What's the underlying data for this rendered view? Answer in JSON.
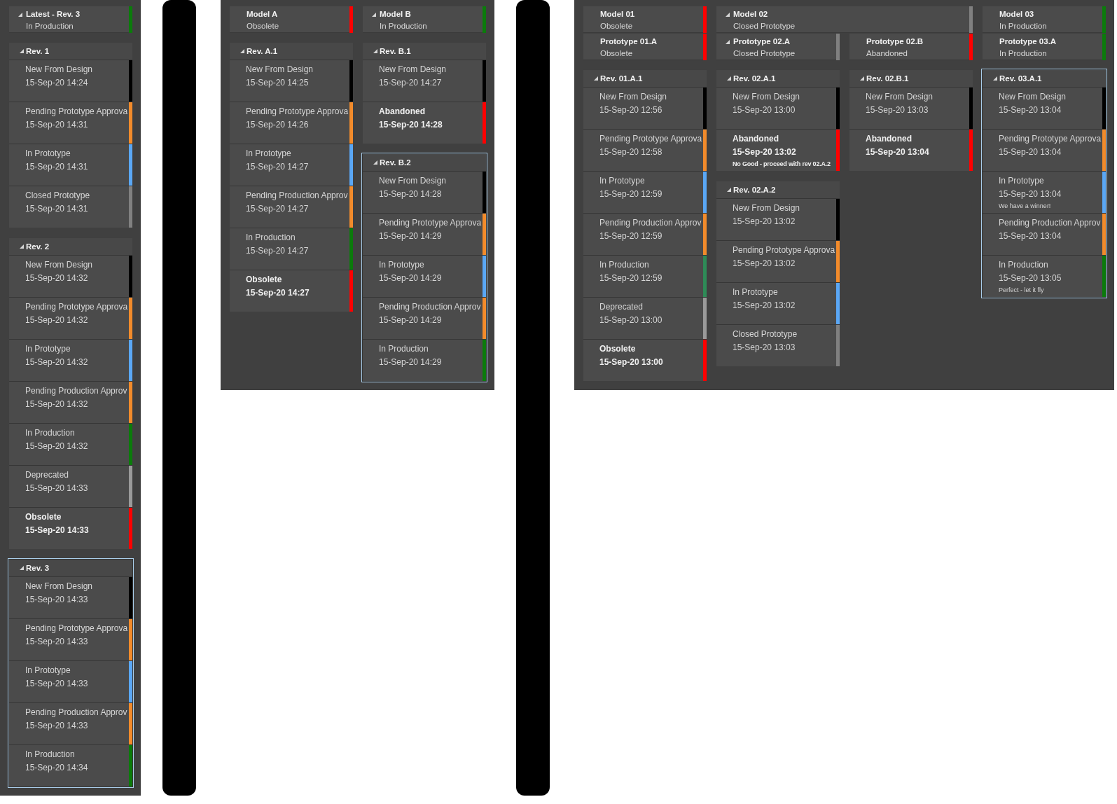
{
  "panels": [
    {
      "nodes": [
        {
          "title": "Latest - Rev. 3",
          "status": "In Production",
          "color": "#0b7b0b",
          "expand_arrow": true,
          "revisions": [
            {
              "title": "Rev. 1",
              "selected": false,
              "states": [
                {
                  "label": "New From Design",
                  "time": "15-Sep-20 14:24",
                  "color": "#000000",
                  "emphasized": false
                },
                {
                  "label": "Pending Prototype Approva",
                  "time": "15-Sep-20 14:31",
                  "color": "#f28b2b",
                  "emphasized": false
                },
                {
                  "label": "In Prototype",
                  "time": "15-Sep-20 14:31",
                  "color": "#5aa7f5",
                  "emphasized": false
                },
                {
                  "label": "Closed Prototype",
                  "time": "15-Sep-20 14:31",
                  "color": "#808080",
                  "emphasized": false
                }
              ]
            },
            {
              "title": "Rev. 2",
              "selected": false,
              "states": [
                {
                  "label": "New From Design",
                  "time": "15-Sep-20 14:32",
                  "color": "#000000",
                  "emphasized": false
                },
                {
                  "label": "Pending Prototype Approva",
                  "time": "15-Sep-20 14:32",
                  "color": "#f28b2b",
                  "emphasized": false
                },
                {
                  "label": "In Prototype",
                  "time": "15-Sep-20 14:32",
                  "color": "#5aa7f5",
                  "emphasized": false
                },
                {
                  "label": "Pending Production Approv",
                  "time": "15-Sep-20 14:32",
                  "color": "#f28b2b",
                  "emphasized": false
                },
                {
                  "label": "In Production",
                  "time": "15-Sep-20 14:32",
                  "color": "#0b7b0b",
                  "emphasized": false
                },
                {
                  "label": "Deprecated",
                  "time": "15-Sep-20 14:33",
                  "color": "#9a9a9a",
                  "emphasized": false
                },
                {
                  "label": "Obsolete",
                  "time": "15-Sep-20 14:33",
                  "color": "#ff0000",
                  "emphasized": true
                }
              ]
            },
            {
              "title": "Rev. 3",
              "selected": true,
              "states": [
                {
                  "label": "New From Design",
                  "time": "15-Sep-20 14:33",
                  "color": "#000000",
                  "emphasized": false
                },
                {
                  "label": "Pending Prototype Approva",
                  "time": "15-Sep-20 14:33",
                  "color": "#f28b2b",
                  "emphasized": false
                },
                {
                  "label": "In Prototype",
                  "time": "15-Sep-20 14:33",
                  "color": "#5aa7f5",
                  "emphasized": false
                },
                {
                  "label": "Pending Production Approv",
                  "time": "15-Sep-20 14:33",
                  "color": "#f28b2b",
                  "emphasized": false
                },
                {
                  "label": "In Production",
                  "time": "15-Sep-20 14:34",
                  "color": "#0b7b0b",
                  "emphasized": false
                }
              ]
            }
          ]
        }
      ]
    },
    {
      "nodes": [
        {
          "title": "Model A",
          "status": "Obsolete",
          "color": "#ff0000",
          "expand_arrow": false,
          "revisions": [
            {
              "title": "Rev. A.1",
              "selected": false,
              "states": [
                {
                  "label": "New From Design",
                  "time": "15-Sep-20 14:25",
                  "color": "#000000",
                  "emphasized": false
                },
                {
                  "label": "Pending Prototype Approva",
                  "time": "15-Sep-20 14:26",
                  "color": "#f28b2b",
                  "emphasized": false
                },
                {
                  "label": "In Prototype",
                  "time": "15-Sep-20 14:27",
                  "color": "#5aa7f5",
                  "emphasized": false
                },
                {
                  "label": "Pending Production Approv",
                  "time": "15-Sep-20 14:27",
                  "color": "#f28b2b",
                  "emphasized": false
                },
                {
                  "label": "In Production",
                  "time": "15-Sep-20 14:27",
                  "color": "#0b7b0b",
                  "emphasized": false
                },
                {
                  "label": "Obsolete",
                  "time": "15-Sep-20 14:27",
                  "color": "#ff0000",
                  "emphasized": true
                }
              ]
            }
          ]
        },
        {
          "title": "Model B",
          "status": "In Production",
          "color": "#0b7b0b",
          "expand_arrow": true,
          "revisions": [
            {
              "title": "Rev. B.1",
              "selected": false,
              "states": [
                {
                  "label": "New From Design",
                  "time": "15-Sep-20 14:27",
                  "color": "#000000",
                  "emphasized": false
                },
                {
                  "label": "Abandoned",
                  "time": "15-Sep-20 14:28",
                  "color": "#ff0000",
                  "emphasized": true
                }
              ]
            },
            {
              "title": "Rev. B.2",
              "selected": true,
              "states": [
                {
                  "label": "New From Design",
                  "time": "15-Sep-20 14:28",
                  "color": "#000000",
                  "emphasized": false
                },
                {
                  "label": "Pending Prototype Approva",
                  "time": "15-Sep-20 14:29",
                  "color": "#f28b2b",
                  "emphasized": false
                },
                {
                  "label": "In Prototype",
                  "time": "15-Sep-20 14:29",
                  "color": "#5aa7f5",
                  "emphasized": false
                },
                {
                  "label": "Pending Production Approv",
                  "time": "15-Sep-20 14:29",
                  "color": "#f28b2b",
                  "emphasized": false
                },
                {
                  "label": "In Production",
                  "time": "15-Sep-20 14:29",
                  "color": "#0b7b0b",
                  "emphasized": false
                }
              ]
            }
          ]
        }
      ]
    },
    {
      "nodes": [
        {
          "title": "Model 01",
          "status": "Obsolete",
          "color": "#ff0000",
          "expand_arrow": false,
          "prototypes": [
            {
              "title": "Prototype 01.A",
              "status": "Obsolete",
              "color": "#ff0000",
              "expand_arrow": false,
              "revisions": [
                {
                  "title": "Rev. 01.A.1",
                  "selected": false,
                  "states": [
                    {
                      "label": "New From Design",
                      "time": "15-Sep-20 12:56",
                      "color": "#000000",
                      "emphasized": false
                    },
                    {
                      "label": "Pending Prototype Approva",
                      "time": "15-Sep-20 12:58",
                      "color": "#f28b2b",
                      "emphasized": false
                    },
                    {
                      "label": "In Prototype",
                      "time": "15-Sep-20 12:59",
                      "color": "#5aa7f5",
                      "emphasized": false
                    },
                    {
                      "label": "Pending Production Approv",
                      "time": "15-Sep-20 12:59",
                      "color": "#f28b2b",
                      "emphasized": false
                    },
                    {
                      "label": "In Production",
                      "time": "15-Sep-20 12:59",
                      "color": "#2e8b57",
                      "emphasized": false
                    },
                    {
                      "label": "Deprecated",
                      "time": "15-Sep-20 13:00",
                      "color": "#9a9a9a",
                      "emphasized": false
                    },
                    {
                      "label": "Obsolete",
                      "time": "15-Sep-20 13:00",
                      "color": "#ff0000",
                      "emphasized": true
                    }
                  ]
                }
              ]
            }
          ]
        },
        {
          "title": "Model 02",
          "status": "Closed Prototype",
          "color": "#808080",
          "expand_arrow": true,
          "prototypes": [
            {
              "title": "Prototype 02.A",
              "status": "Closed Prototype",
              "color": "#808080",
              "expand_arrow": true,
              "revisions": [
                {
                  "title": "Rev. 02.A.1",
                  "selected": false,
                  "states": [
                    {
                      "label": "New From Design",
                      "time": "15-Sep-20 13:00",
                      "color": "#000000",
                      "emphasized": false
                    },
                    {
                      "label": "Abandoned",
                      "time": "15-Sep-20 13:02",
                      "note": "No Good - proceed with rev 02.A.2",
                      "color": "#ff0000",
                      "emphasized": true
                    }
                  ]
                },
                {
                  "title": "Rev. 02.A.2",
                  "selected": false,
                  "states": [
                    {
                      "label": "New From Design",
                      "time": "15-Sep-20 13:02",
                      "color": "#000000",
                      "emphasized": false
                    },
                    {
                      "label": "Pending Prototype Approva",
                      "time": "15-Sep-20 13:02",
                      "color": "#f28b2b",
                      "emphasized": false
                    },
                    {
                      "label": "In Prototype",
                      "time": "15-Sep-20 13:02",
                      "color": "#5aa7f5",
                      "emphasized": false
                    },
                    {
                      "label": "Closed Prototype",
                      "time": "15-Sep-20 13:03",
                      "color": "#808080",
                      "emphasized": false
                    }
                  ]
                }
              ]
            },
            {
              "title": "Prototype 02.B",
              "status": "Abandoned",
              "color": "#ff0000",
              "expand_arrow": false,
              "revisions": [
                {
                  "title": "Rev. 02.B.1",
                  "selected": false,
                  "states": [
                    {
                      "label": "New From Design",
                      "time": "15-Sep-20 13:03",
                      "color": "#000000",
                      "emphasized": false
                    },
                    {
                      "label": "Abandoned",
                      "time": "15-Sep-20 13:04",
                      "color": "#ff0000",
                      "emphasized": true
                    }
                  ]
                }
              ]
            }
          ]
        },
        {
          "title": "Model 03",
          "status": "In Production",
          "color": "#0b7b0b",
          "expand_arrow": false,
          "prototypes": [
            {
              "title": "Prototype 03.A",
              "status": "In Production",
              "color": "#0b7b0b",
              "expand_arrow": false,
              "revisions": [
                {
                  "title": "Rev. 03.A.1",
                  "selected": true,
                  "states": [
                    {
                      "label": "New From Design",
                      "time": "15-Sep-20 13:04",
                      "color": "#000000",
                      "emphasized": false
                    },
                    {
                      "label": "Pending Prototype Approva",
                      "time": "15-Sep-20 13:04",
                      "color": "#f28b2b",
                      "emphasized": false
                    },
                    {
                      "label": "In Prototype",
                      "time": "15-Sep-20 13:04",
                      "note": "We have a winner!",
                      "color": "#5aa7f5",
                      "emphasized": false
                    },
                    {
                      "label": "Pending Production Approv",
                      "time": "15-Sep-20 13:04",
                      "color": "#f28b2b",
                      "emphasized": false
                    },
                    {
                      "label": "In Production",
                      "time": "15-Sep-20 13:05",
                      "note": "Perfect - let it fly",
                      "color": "#0b7b0b",
                      "emphasized": false
                    }
                  ]
                }
              ]
            }
          ]
        }
      ]
    }
  ]
}
